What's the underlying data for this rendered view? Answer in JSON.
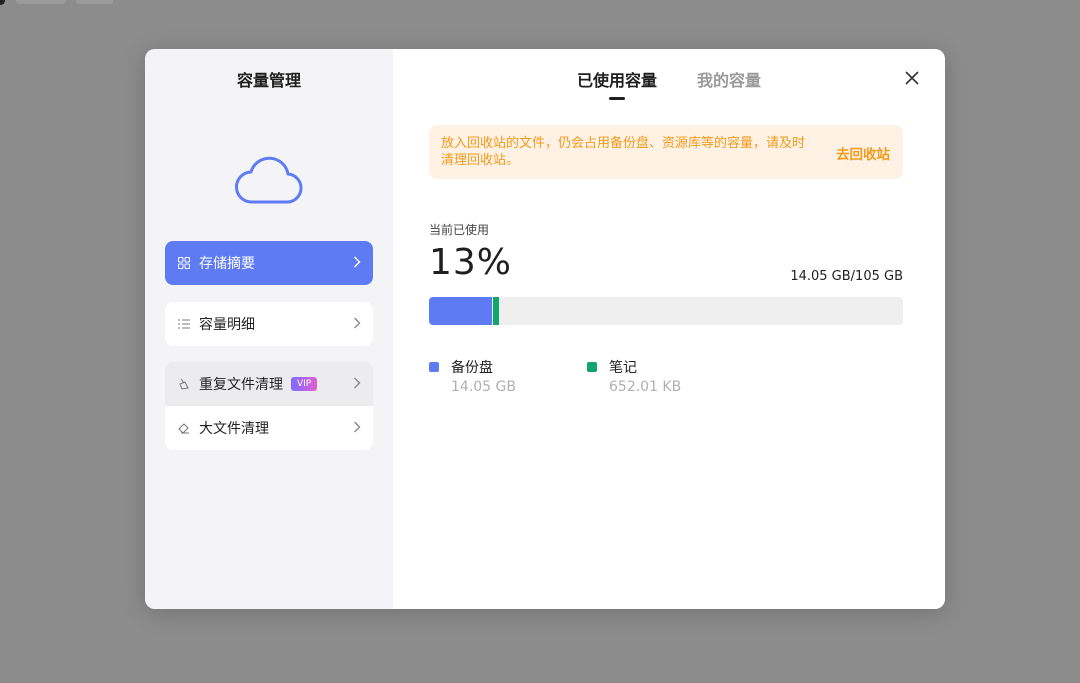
{
  "colors": {
    "accent": "#5f7bf4",
    "notes": "#11a66b",
    "warning": "#f09a1a"
  },
  "sidebar": {
    "title": "容量管理",
    "items": [
      {
        "label": "存储摘要",
        "icon": "grid-icon"
      },
      {
        "label": "容量明细",
        "icon": "list-icon"
      },
      {
        "label": "重复文件清理",
        "icon": "broom-icon",
        "badge": "VIP"
      },
      {
        "label": "大文件清理",
        "icon": "eraser-icon"
      }
    ]
  },
  "tabs": [
    {
      "label": "已使用容量"
    },
    {
      "label": "我的容量"
    }
  ],
  "notice": {
    "text": "放入回收站的文件，仍会占用备份盘、资源库等的容量，请及时清理回收站。",
    "action": "去回收站"
  },
  "usage": {
    "label": "当前已使用",
    "percent": "13%",
    "total_text": "14.05 GB/105 GB",
    "segments": [
      {
        "name": "备份盘",
        "value_text": "14.05 GB",
        "fraction": 0.1338,
        "color": "#5f7bf4"
      },
      {
        "name": "笔记",
        "value_text": "652.01 KB",
        "fraction": 0.012,
        "color": "#11a66b"
      }
    ]
  }
}
